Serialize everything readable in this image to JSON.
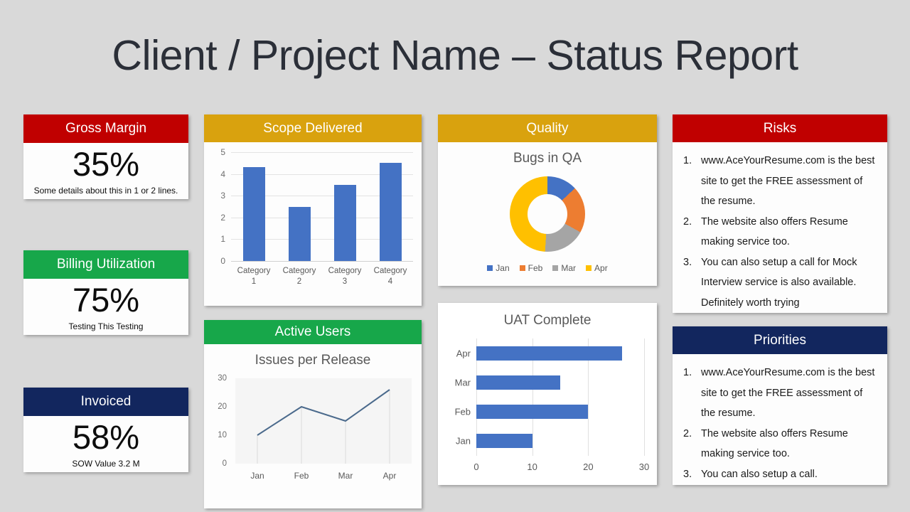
{
  "title": "Client / Project Name – Status Report",
  "colors": {
    "red": "#c00000",
    "green": "#17a74a",
    "navy": "#12265e",
    "amber": "#d9a20e",
    "bar_blue": "#4472c4",
    "line_blue": "#4b6a8c",
    "page_bg": "#d9d9d9"
  },
  "kpis": [
    {
      "title": "Gross Margin",
      "value": "35%",
      "note": "Some details about this in 1 or 2 lines."
    },
    {
      "title": "Billing Utilization",
      "value": "75%",
      "note": "Testing This Testing"
    },
    {
      "title": "Invoiced",
      "value": "58%",
      "note": "SOW Value 3.2 M"
    }
  ],
  "panels": {
    "scope": "Scope Delivered",
    "quality": "Quality",
    "active_users": "Active Users",
    "risks": "Risks",
    "priorities": "Priorities"
  },
  "risks": [
    "www.AceYourResume.com is the best site to get the FREE assessment of the resume.",
    "The website also offers Resume making service too.",
    "You can also setup a call for Mock Interview service is also available. Definitely worth trying"
  ],
  "priorities": [
    "www.AceYourResume.com is the best site to get the FREE assessment of the resume.",
    "The website also offers Resume making service too.",
    "You can also setup a call."
  ],
  "chart_data": [
    {
      "type": "bar",
      "id": "scope-delivered",
      "title": "",
      "categories": [
        "Category 1",
        "Category 2",
        "Category 3",
        "Category 4"
      ],
      "values": [
        4.3,
        2.5,
        3.5,
        4.5
      ],
      "xlabel": "",
      "ylabel": "",
      "ylim": [
        0,
        5
      ],
      "yticks": [
        0,
        1,
        2,
        3,
        4,
        5
      ],
      "grid": true,
      "legend": "none",
      "color": "#4472c4"
    },
    {
      "type": "pie",
      "id": "bugs-in-qa",
      "title": "Bugs in QA",
      "labels": [
        "Jan",
        "Feb",
        "Mar",
        "Apr"
      ],
      "values": [
        13,
        20,
        18,
        49
      ],
      "colors": [
        "#4472c4",
        "#ed7d31",
        "#a5a5a5",
        "#ffc000"
      ],
      "legend": "bottom",
      "donut": true
    },
    {
      "type": "line",
      "id": "issues-per-release",
      "title": "Issues per Release",
      "categories": [
        "Jan",
        "Feb",
        "Mar",
        "Apr"
      ],
      "values": [
        10,
        20,
        15,
        26
      ],
      "xlabel": "",
      "ylabel": "",
      "ylim": [
        0,
        30
      ],
      "yticks": [
        0,
        10,
        20,
        30
      ],
      "grid": false,
      "legend": "none",
      "color": "#4b6a8c"
    },
    {
      "type": "bar",
      "id": "uat-complete",
      "title": "UAT Complete",
      "orientation": "horizontal",
      "categories": [
        "Jan",
        "Feb",
        "Mar",
        "Apr"
      ],
      "values": [
        10,
        20,
        15,
        26
      ],
      "xlabel": "",
      "ylabel": "",
      "xlim": [
        0,
        30
      ],
      "xticks": [
        0,
        10,
        20,
        30
      ],
      "grid": true,
      "legend": "none",
      "color": "#4472c4"
    }
  ]
}
